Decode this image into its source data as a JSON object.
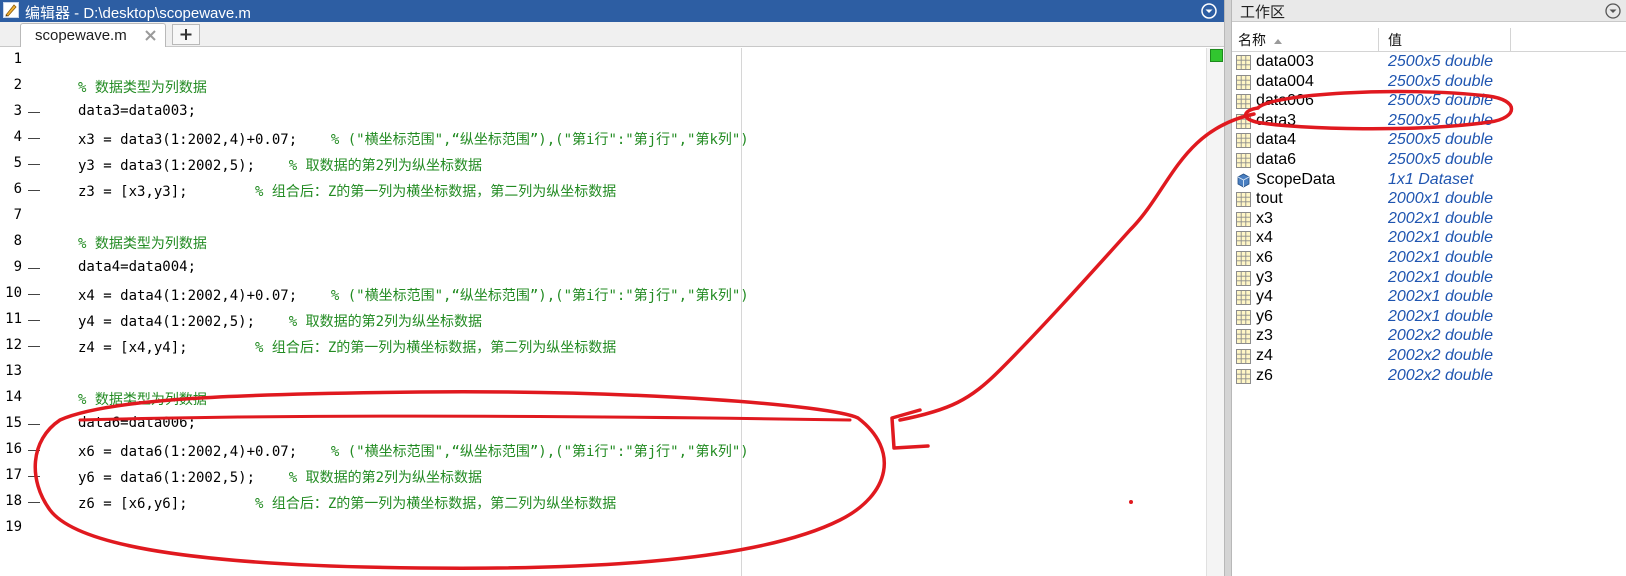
{
  "editor": {
    "title": "编辑器 - D:\\desktop\\scopewave.m",
    "tab_label": "scopewave.m",
    "add_tab_label": "+",
    "lines": [
      {
        "num": "1",
        "code": "",
        "comment": "",
        "exec": false
      },
      {
        "num": "2",
        "code": "",
        "comment": "% 数据类型为列数据",
        "exec": false
      },
      {
        "num": "3",
        "code": "data3=data003;",
        "comment": "",
        "exec": true
      },
      {
        "num": "4",
        "code": "x3 = data3(1:2002,4)+0.07;    ",
        "comment": "% (\"横坐标范围\",“纵坐标范围”),(\"第i行\":\"第j行\",\"第k列\")",
        "exec": true
      },
      {
        "num": "5",
        "code": "y3 = data3(1:2002,5);    ",
        "comment": "% 取数据的第2列为纵坐标数据",
        "exec": true
      },
      {
        "num": "6",
        "code": "z3 = [x3,y3];        ",
        "comment": "% 组合后：Z的第一列为横坐标数据，第二列为纵坐标数据",
        "exec": true
      },
      {
        "num": "7",
        "code": "",
        "comment": "",
        "exec": false
      },
      {
        "num": "8",
        "code": "",
        "comment": "% 数据类型为列数据",
        "exec": false
      },
      {
        "num": "9",
        "code": "data4=data004;",
        "comment": "",
        "exec": true
      },
      {
        "num": "10",
        "code": "x4 = data4(1:2002,4)+0.07;    ",
        "comment": "% (\"横坐标范围\",“纵坐标范围”),(\"第i行\":\"第j行\",\"第k列\")",
        "exec": true
      },
      {
        "num": "11",
        "code": "y4 = data4(1:2002,5);    ",
        "comment": "% 取数据的第2列为纵坐标数据",
        "exec": true
      },
      {
        "num": "12",
        "code": "z4 = [x4,y4];        ",
        "comment": "% 组合后：Z的第一列为横坐标数据，第二列为纵坐标数据",
        "exec": true
      },
      {
        "num": "13",
        "code": "",
        "comment": "",
        "exec": false
      },
      {
        "num": "14",
        "code": "",
        "comment": "% 数据类型为列数据",
        "exec": false
      },
      {
        "num": "15",
        "code": "data6=data006;",
        "comment": "",
        "exec": true
      },
      {
        "num": "16",
        "code": "x6 = data6(1:2002,4)+0.07;    ",
        "comment": "% (\"横坐标范围\",“纵坐标范围”),(\"第i行\":\"第j行\",\"第k列\")",
        "exec": true
      },
      {
        "num": "17",
        "code": "y6 = data6(1:2002,5);    ",
        "comment": "% 取数据的第2列为纵坐标数据",
        "exec": true
      },
      {
        "num": "18",
        "code": "z6 = [x6,y6];        ",
        "comment": "% 组合后：Z的第一列为横坐标数据，第二列为纵坐标数据",
        "exec": true
      },
      {
        "num": "19",
        "code": "",
        "comment": "",
        "exec": false
      }
    ]
  },
  "workspace": {
    "title": "工作区",
    "col_name": "名称",
    "col_value": "值",
    "variables": [
      {
        "name": "data003",
        "value": "2500x5 double",
        "icon": "matrix-icon"
      },
      {
        "name": "data004",
        "value": "2500x5 double",
        "icon": "matrix-icon"
      },
      {
        "name": "data006",
        "value": "2500x5 double",
        "icon": "matrix-icon"
      },
      {
        "name": "data3",
        "value": "2500x5 double",
        "icon": "matrix-icon"
      },
      {
        "name": "data4",
        "value": "2500x5 double",
        "icon": "matrix-icon"
      },
      {
        "name": "data6",
        "value": "2500x5 double",
        "icon": "matrix-icon"
      },
      {
        "name": "ScopeData",
        "value": "1x1 Dataset",
        "icon": "dataset-icon"
      },
      {
        "name": "tout",
        "value": "2000x1 double",
        "icon": "matrix-icon"
      },
      {
        "name": "x3",
        "value": "2002x1 double",
        "icon": "matrix-icon"
      },
      {
        "name": "x4",
        "value": "2002x1 double",
        "icon": "matrix-icon"
      },
      {
        "name": "x6",
        "value": "2002x1 double",
        "icon": "matrix-icon"
      },
      {
        "name": "y3",
        "value": "2002x1 double",
        "icon": "matrix-icon"
      },
      {
        "name": "y4",
        "value": "2002x1 double",
        "icon": "matrix-icon"
      },
      {
        "name": "y6",
        "value": "2002x1 double",
        "icon": "matrix-icon"
      },
      {
        "name": "z3",
        "value": "2002x2 double",
        "icon": "matrix-icon"
      },
      {
        "name": "z4",
        "value": "2002x2 double",
        "icon": "matrix-icon"
      },
      {
        "name": "z6",
        "value": "2002x2 double",
        "icon": "matrix-icon"
      }
    ]
  },
  "colors": {
    "title_bar": "#2d5ea3",
    "comment": "#228b22",
    "value_text": "#1f55b0",
    "annotation": "#e0191f",
    "status_ok": "#31c62f"
  }
}
